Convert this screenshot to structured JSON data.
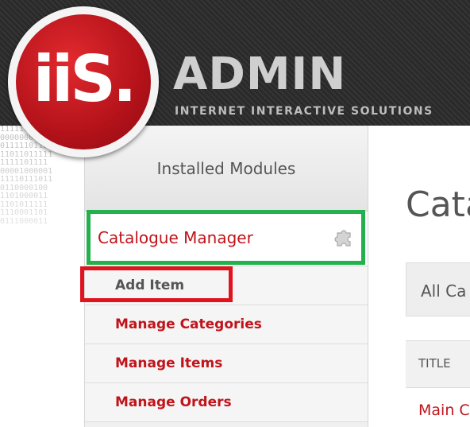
{
  "header": {
    "logo_text": "iiS.",
    "title": "ADMIN",
    "subtitle": "INTERNET INTERACTIVE SOLUTIONS"
  },
  "background": {
    "binary_lines": [
      "11111011101",
      "000000011101",
      "01111101101",
      "11011011111",
      "1111101111",
      "00001000001",
      "11110111011",
      "0110000100",
      "1101000011",
      "1101011111",
      "1110001101",
      "0111000011"
    ]
  },
  "sidebar": {
    "header_label": "Installed Modules",
    "module": {
      "label": "Catalogue Manager",
      "icon": "puzzle-icon"
    },
    "items": [
      {
        "label": "Add Item"
      },
      {
        "label": "Manage Categories"
      },
      {
        "label": "Manage Items"
      },
      {
        "label": "Manage Orders"
      }
    ]
  },
  "main": {
    "title": "Cata",
    "filter_label": "All Ca",
    "table_header": "TITLE",
    "first_cell": "Main C"
  },
  "colors": {
    "accent": "#c0141b",
    "highlight_green": "#22b14c",
    "highlight_red": "#e0141e"
  }
}
